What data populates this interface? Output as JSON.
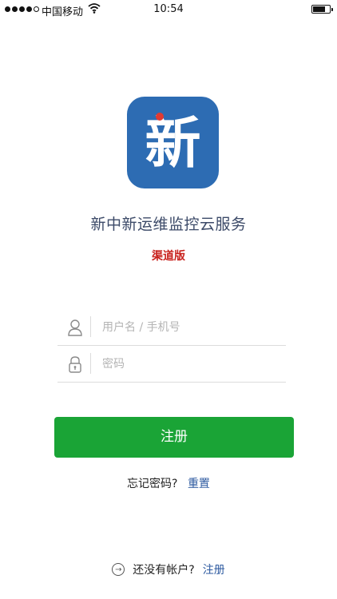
{
  "status_bar": {
    "carrier": "中国移动",
    "time": "10:54",
    "signal_bars_filled": 4,
    "signal_bars_total": 5,
    "battery_level": 0.75,
    "wifi_icon": "wifi-icon"
  },
  "logo": {
    "char": "新",
    "bg_color": "#2d6cb3",
    "dot_color": "#e03a32"
  },
  "app_title": "新中新运维监控云服务",
  "edition": "渠道版",
  "form": {
    "username_placeholder": "用户名 / 手机号",
    "password_placeholder": "密码",
    "username_value": "",
    "password_value": "",
    "username_icon": "user-icon",
    "password_icon": "lock-icon"
  },
  "register_button_label": "注册",
  "forgot": {
    "text": "忘记密码?",
    "reset_link": "重置"
  },
  "signup": {
    "text": "还没有帐户?",
    "link": "注册",
    "icon": "arrow-right-circle-icon"
  },
  "colors": {
    "primary_green": "#1aa436",
    "link_blue": "#2d5aa0",
    "accent_red": "#c8211d"
  }
}
